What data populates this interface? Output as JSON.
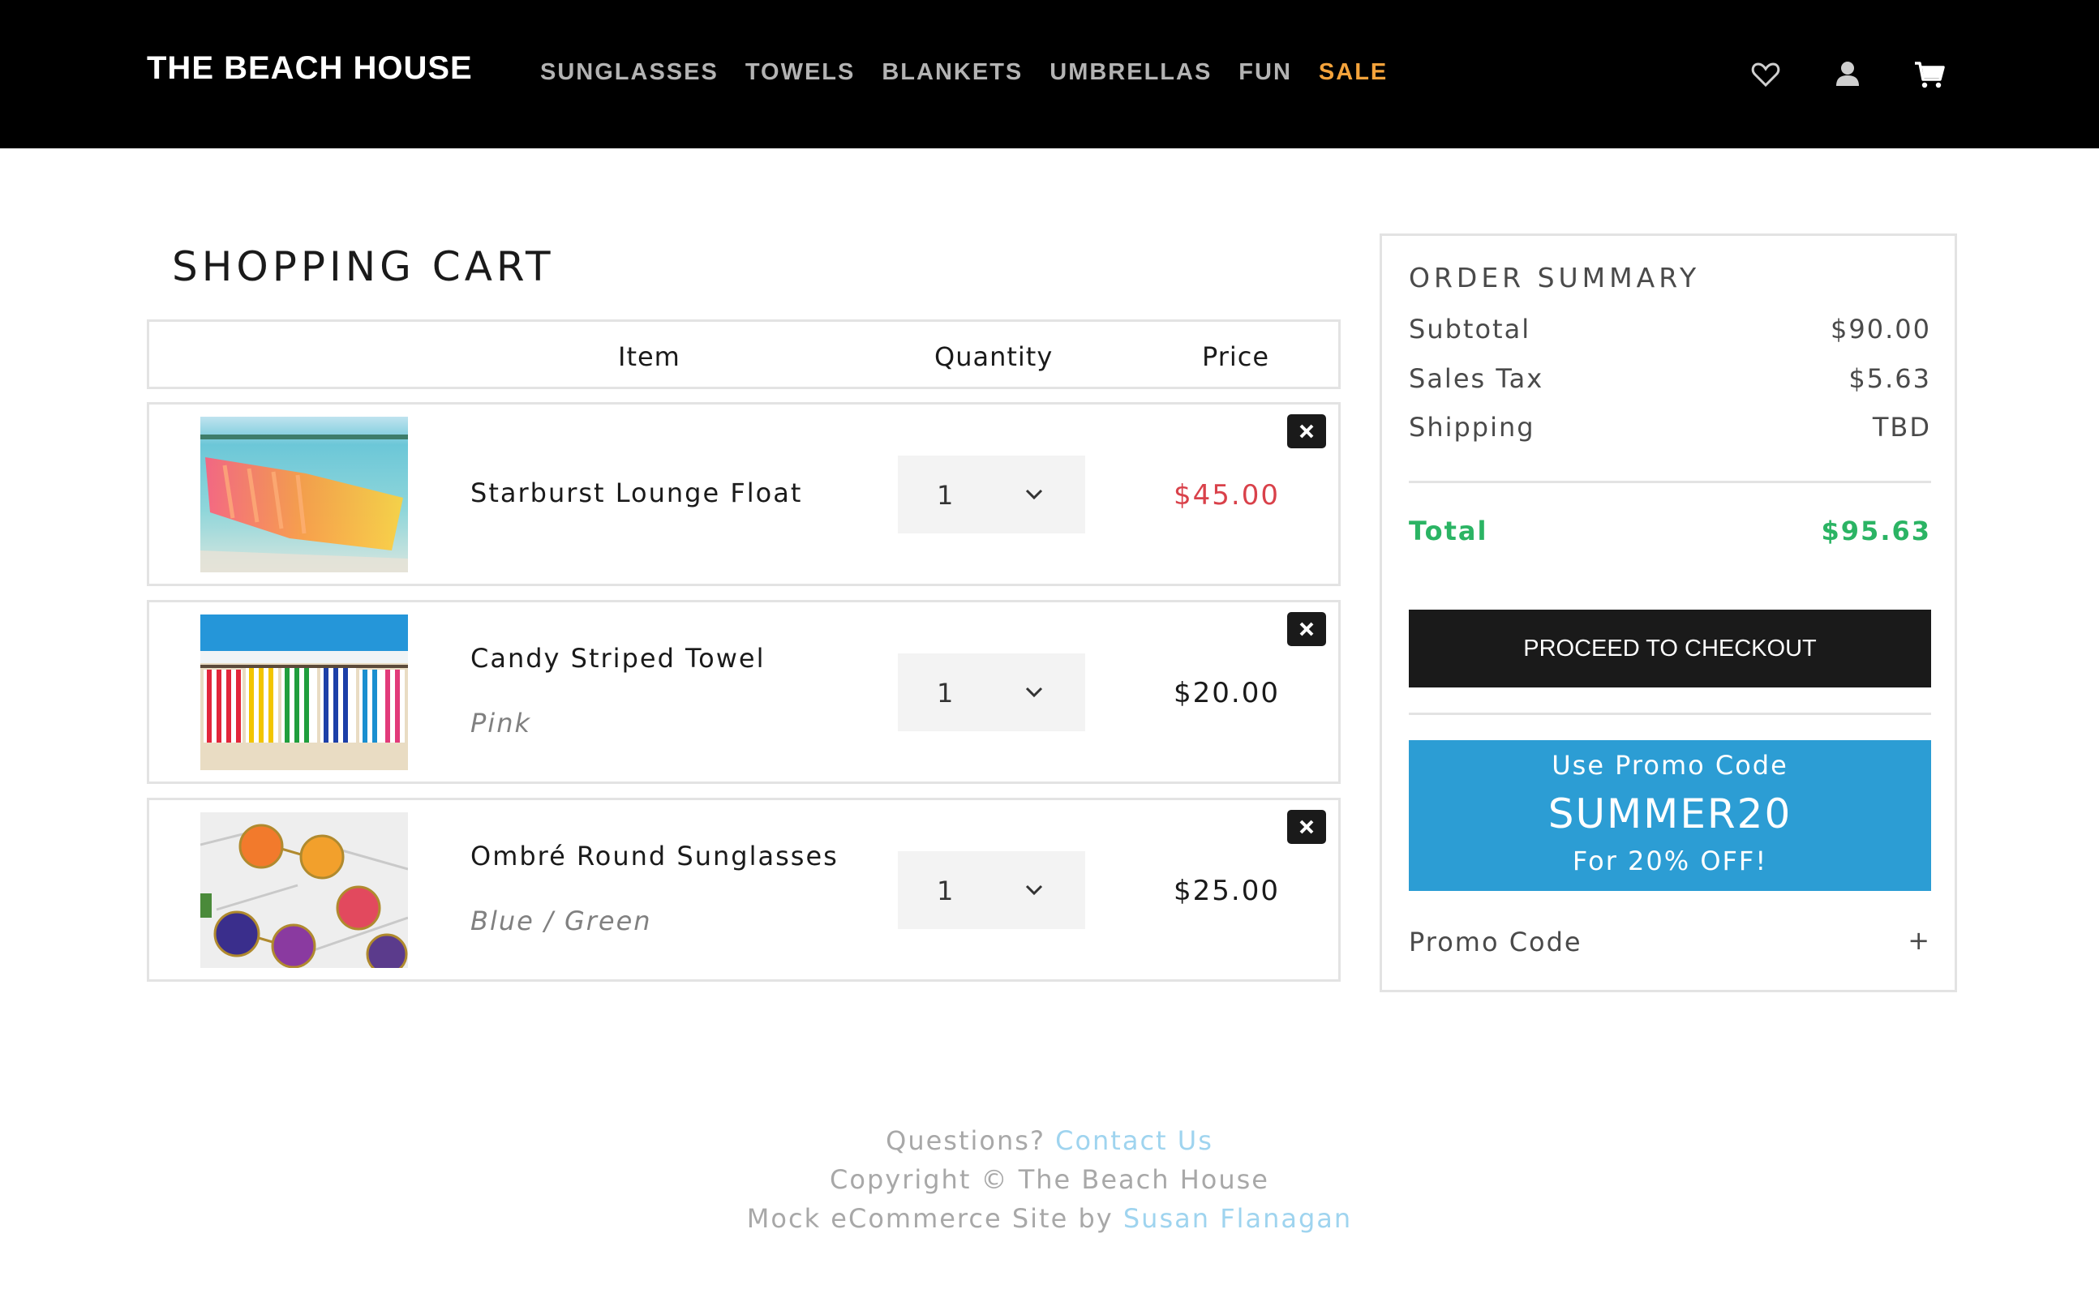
{
  "header": {
    "brand": "THE BEACH HOUSE",
    "nav": [
      "SUNGLASSES",
      "TOWELS",
      "BLANKETS",
      "UMBRELLAS",
      "FUN",
      "SALE"
    ],
    "icons": [
      "heart-icon",
      "user-icon",
      "cart-icon"
    ]
  },
  "cart": {
    "title": "SHOPPING CART",
    "columns": {
      "item": "Item",
      "quantity": "Quantity",
      "price": "Price"
    },
    "items": [
      {
        "name": "Starburst Lounge Float",
        "variant": "",
        "quantity": "1",
        "price": "$45.00",
        "price_color": "#d9414a",
        "image": "pool-float-photo"
      },
      {
        "name": "Candy Striped Towel",
        "variant": "Pink",
        "quantity": "1",
        "price": "$20.00",
        "image": "striped-towels-photo"
      },
      {
        "name": "Ombré Round Sunglasses",
        "variant": "Blue / Green",
        "quantity": "1",
        "price": "$25.00",
        "image": "round-sunglasses-photo"
      }
    ]
  },
  "summary": {
    "title": "ORDER SUMMARY",
    "subtotal_label": "Subtotal",
    "subtotal": "$90.00",
    "tax_label": "Sales Tax",
    "tax": "$5.63",
    "shipping_label": "Shipping",
    "shipping": "TBD",
    "total_label": "Total",
    "total": "$95.63",
    "checkout_label": "PROCEED TO CHECKOUT",
    "promo_line1": "Use Promo Code",
    "promo_code": "SUMMER20",
    "promo_line3": "For 20% OFF!",
    "promo_field_label": "Promo Code",
    "promo_toggle": "+"
  },
  "footer": {
    "questions": "Questions?",
    "contact_link": "Contact Us",
    "copyright": "Copyright © The Beach House",
    "credit": "Mock eCommerce Site by",
    "author_link": "Susan Flanagan"
  },
  "colors": {
    "header_bg": "#000000",
    "sale": "#f5a33b",
    "price_red": "#d9414a",
    "total_green": "#2bb464",
    "promo_blue": "#2c9dd4",
    "link_blue": "#9fd4ef"
  }
}
